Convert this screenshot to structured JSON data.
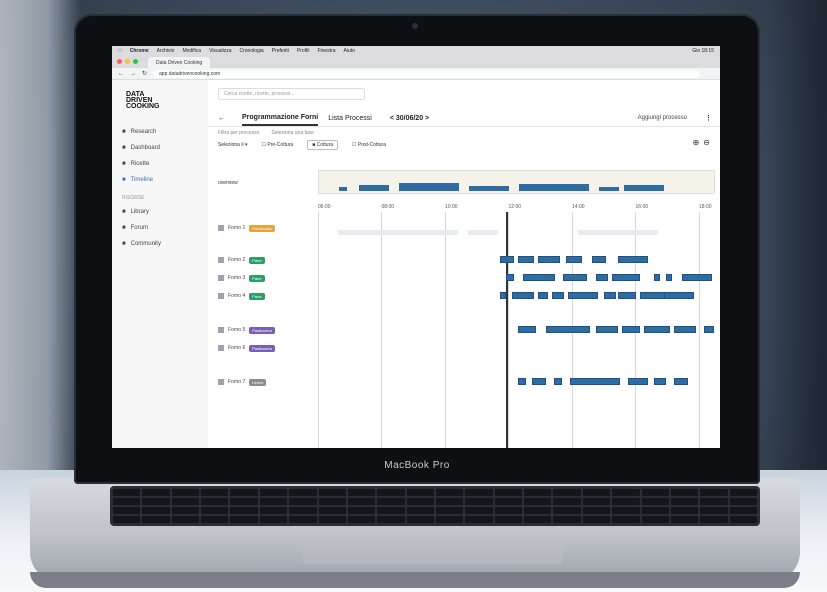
{
  "laptop": {
    "brand_label": "MacBook Pro"
  },
  "menubar": {
    "items": [
      "Chrome",
      "Archivio",
      "Modifica",
      "Visualizza",
      "Cronologia",
      "Preferiti",
      "Profili",
      "Finestra",
      "Aiuto"
    ],
    "clock": "Gio 18:15"
  },
  "browser": {
    "tab_title": "Data Driven Cooking",
    "url": "app.datadrivencooking.com"
  },
  "sidebar": {
    "logo": "DATA\nDRIVEN\nCOOKING",
    "items": [
      {
        "label": "Research",
        "icon": "lab-icon"
      },
      {
        "label": "Dashboard",
        "icon": "dashboard-icon"
      },
      {
        "label": "Ricette",
        "icon": "recipe-icon"
      },
      {
        "label": "Timeline",
        "icon": "timeline-icon",
        "active": true
      }
    ],
    "section_label": "RISORSE",
    "items2": [
      {
        "label": "Library",
        "icon": "library-icon"
      },
      {
        "label": "Forum",
        "icon": "forum-icon"
      },
      {
        "label": "Community",
        "icon": "community-icon"
      }
    ]
  },
  "main": {
    "search_placeholder": "Cerca ricette, ricette, processi...",
    "tabs": {
      "back": "←",
      "active": "Programmazione Forni",
      "other": "Lista Processi",
      "date": "< 30/06/20 >",
      "add_button": "Aggiungi processo",
      "kebab": "⋮"
    },
    "filters_top": [
      "Filtra per processo",
      "Seleziona una fase"
    ],
    "filters": {
      "select": "Seleziona il ▾",
      "check1": "Pre-Cottura",
      "check2": "Cottura",
      "check3": "Post-Cottura"
    },
    "zoom": {
      "in": "⊕",
      "out": "⊖"
    },
    "overview_label": "overview",
    "axis_ticks": [
      "06:00",
      "08:00",
      "10:00",
      "12:00",
      "14:00",
      "16:00",
      "18:00"
    ],
    "rows": [
      {
        "label": "Forno 1",
        "badge": "Preriscaldo",
        "badge_color": "#e6a23c"
      },
      {
        "label": "Forno 2",
        "badge": "Pane",
        "badge_color": "#2e9d6a"
      },
      {
        "label": "Forno 3",
        "badge": "Pane",
        "badge_color": "#2e9d6a"
      },
      {
        "label": "Forno 4",
        "badge": "Pane",
        "badge_color": "#2e9d6a"
      },
      {
        "label": "Forno 5",
        "badge": "Pasticceria",
        "badge_color": "#7b5fb7"
      },
      {
        "label": "Forno 6",
        "badge": "Pasticceria",
        "badge_color": "#7b5fb7"
      },
      {
        "label": "Forno 7",
        "badge": "Libero",
        "badge_color": "#8c8c8c"
      }
    ]
  },
  "colors": {
    "task_blue": "#2e6da4",
    "accent": "#3a6fb4"
  }
}
